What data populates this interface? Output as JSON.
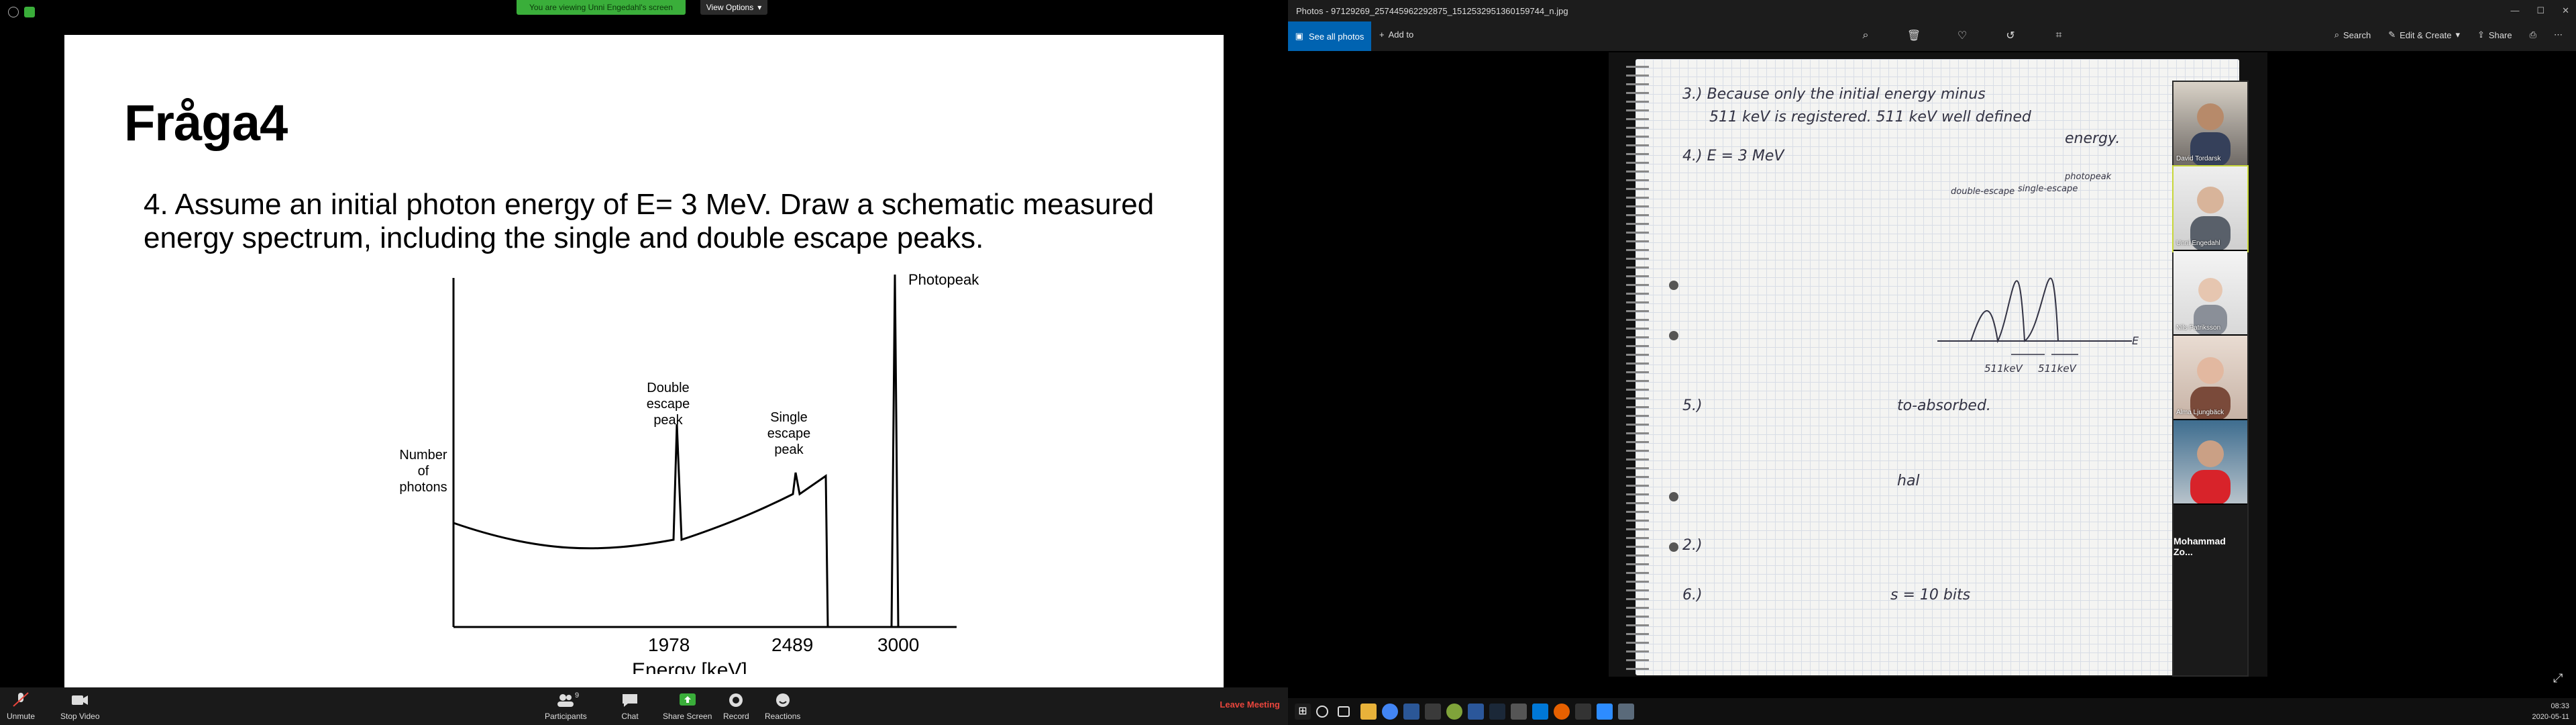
{
  "zoom": {
    "viewing_banner": "You are viewing Unni Engedahl's screen",
    "view_options": "View Options",
    "toolbar": {
      "unmute": "Unmute",
      "stop_video": "Stop Video",
      "participants": "Participants",
      "participants_count": "9",
      "chat": "Chat",
      "share_screen": "Share Screen",
      "record": "Record",
      "reactions": "Reactions",
      "leave": "Leave Meeting"
    },
    "slide": {
      "title": "Fråga4",
      "question": "4. Assume an initial photon energy of E= 3 MeV. Draw a schematic measured energy spectrum, including the single and double escape peaks."
    }
  },
  "chart_data": {
    "type": "line",
    "xlabel": "Energy [keV]",
    "ylabel": "Number of photons",
    "x_ticks": [
      "1978",
      "2489",
      "3000"
    ],
    "annotations": [
      {
        "text": "Double escape peak",
        "x": 1978
      },
      {
        "text": "Single escape peak",
        "x": 2489
      },
      {
        "text": "Photopeak",
        "x": 3000
      }
    ],
    "peaks_keV": [
      1978,
      2489,
      3000
    ],
    "compton_edge_keV": 2600
  },
  "photos": {
    "window_title": "Photos - 97129269_257445962292875_1512532951360159744_n.jpg",
    "see_all": "See all photos",
    "add_to": "Add to",
    "search": "Search",
    "edit_create": "Edit & Create",
    "share": "Share",
    "notebook_lines": [
      "3.) Because only the initial energy minus",
      "511 keV is registered. 511 keV well defined",
      "energy.",
      "4.) E = 3 MeV",
      "double-escape",
      "single-escape",
      "photopeak",
      "511keV",
      "511keV",
      "E",
      "5.)",
      "to-absorbed.",
      "hal",
      "2.)",
      "6.)",
      "s = 10 bits"
    ]
  },
  "participants": [
    {
      "name": "David Tordarsk"
    },
    {
      "name": "Unni Engedahl"
    },
    {
      "name": "Nils Patriksson"
    },
    {
      "name": "Alma Ljungbäck"
    },
    {
      "name": ""
    },
    {
      "name": "Mohammad  Zo..."
    }
  ],
  "taskbar": {
    "time": "08:33",
    "date": "2020-05-11"
  }
}
